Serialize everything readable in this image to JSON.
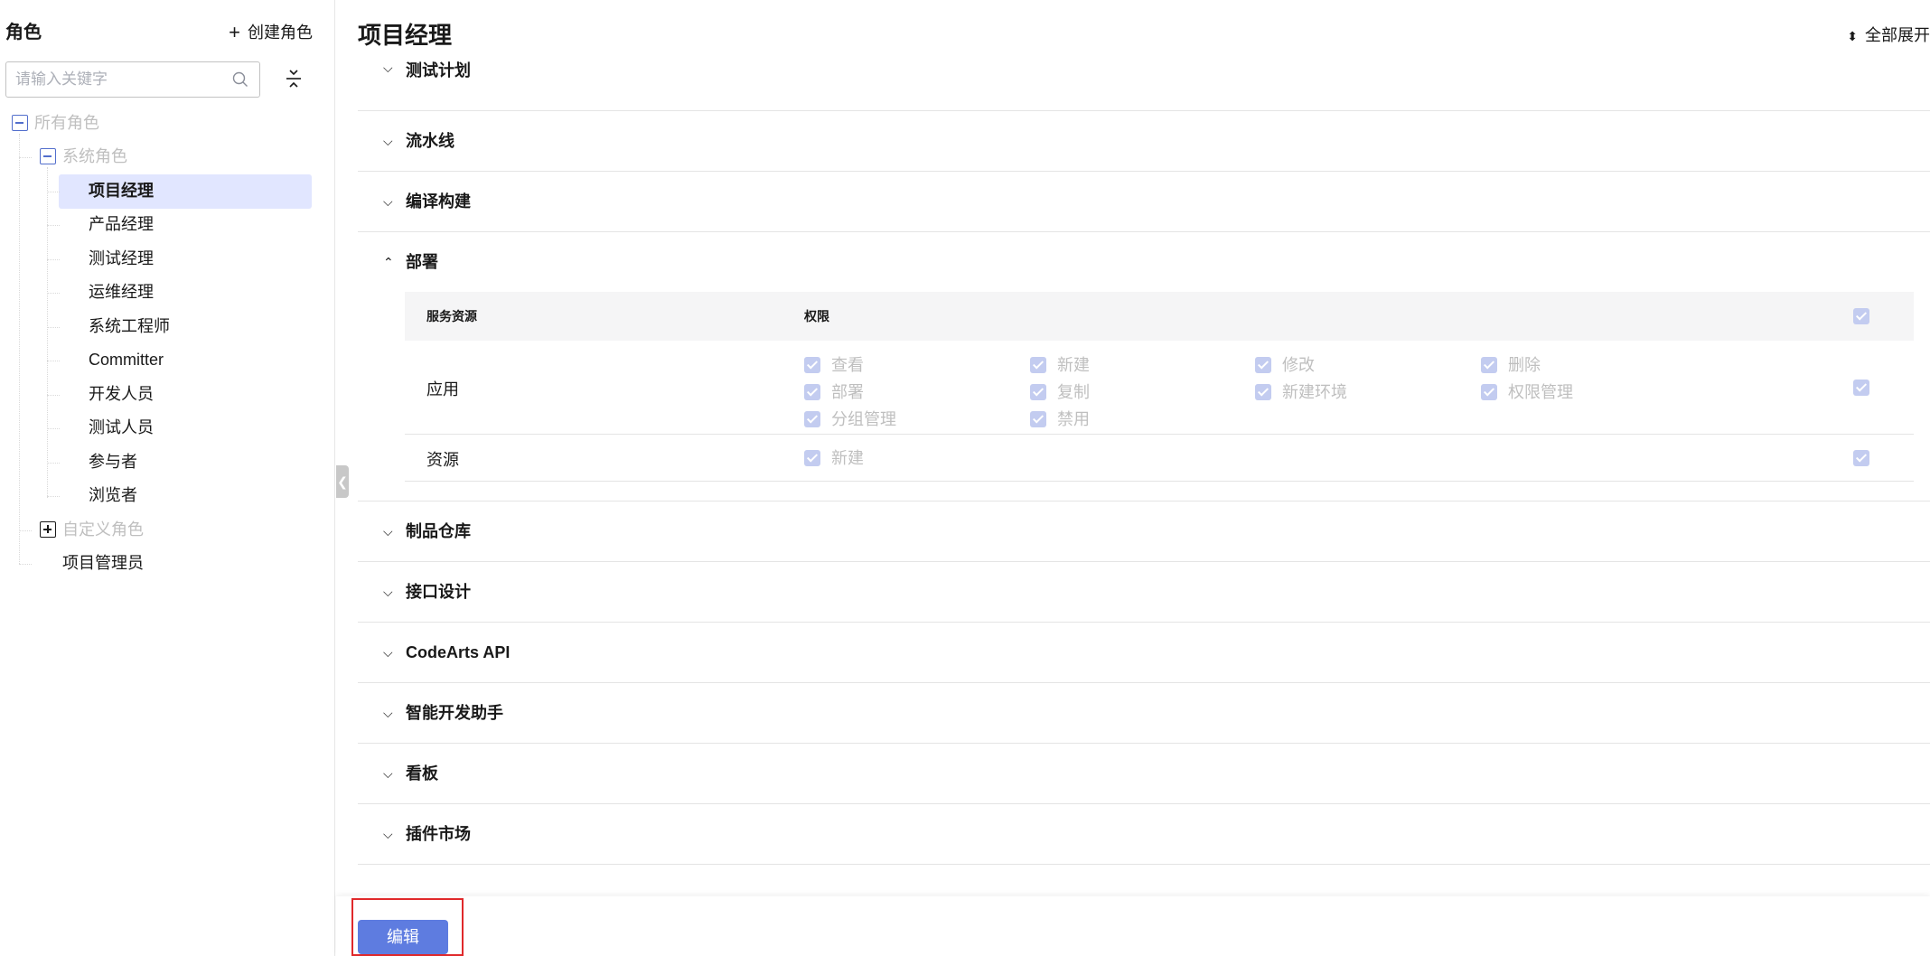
{
  "sidebar": {
    "title": "角色",
    "create_label": "创建角色",
    "search_placeholder": "请输入关键字",
    "tree": {
      "all_roles": "所有角色",
      "system_roles": "系统角色",
      "system_items": [
        "项目经理",
        "产品经理",
        "测试经理",
        "运维经理",
        "系统工程师",
        "Committer",
        "开发人员",
        "测试人员",
        "参与者",
        "浏览者"
      ],
      "custom_roles": "自定义角色",
      "custom_item": "项目管理员"
    },
    "selected": "项目经理"
  },
  "main": {
    "title": "项目经理",
    "expand_all": "全部展开",
    "sections_top": [
      "测试计划",
      "流水线",
      "编译构建"
    ],
    "expanded_section": "部署",
    "table": {
      "col_resource": "服务资源",
      "col_permission": "权限",
      "rows": [
        {
          "name": "应用",
          "perms": [
            "查看",
            "新建",
            "修改",
            "删除",
            "部署",
            "复制",
            "新建环境",
            "权限管理",
            "分组管理",
            "禁用"
          ]
        },
        {
          "name": "资源",
          "perms": [
            "新建"
          ]
        }
      ]
    },
    "sections_bottom": [
      "制品仓库",
      "接口设计",
      "CodeArts API",
      "智能开发助手",
      "看板",
      "插件市场"
    ]
  },
  "footer": {
    "edit_label": "编辑"
  },
  "colors": {
    "accent": "#5e7ce0",
    "selected_bg": "#e1e6ff",
    "checkbox_disabled": "#c3ccf0",
    "highlight": "#e0292b"
  }
}
